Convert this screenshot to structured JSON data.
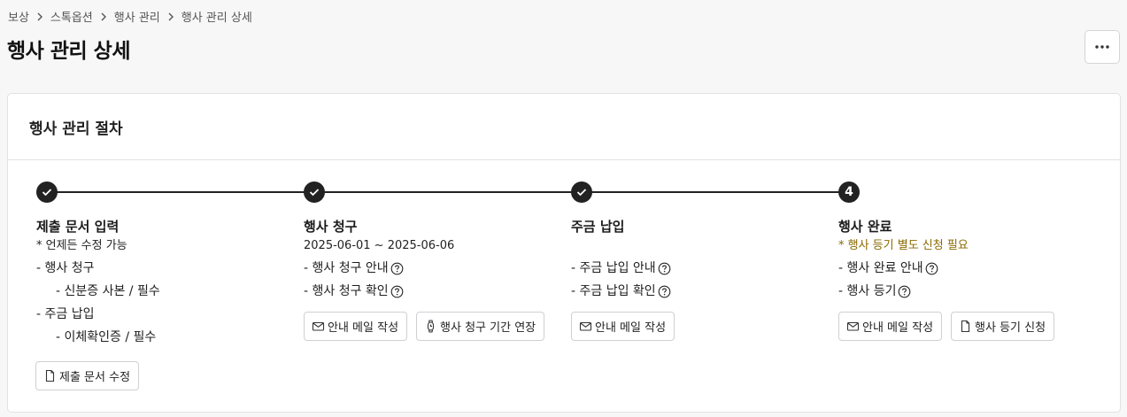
{
  "breadcrumb": [
    "보상",
    "스톡옵션",
    "행사 관리",
    "행사 관리 상세"
  ],
  "page_title": "행사 관리 상세",
  "card": {
    "title": "행사 관리 절차",
    "steps": [
      {
        "marker": "",
        "status": "completed",
        "title": "제출 문서 입력",
        "subtitle": "* 언제든 수정 가능",
        "items": [
          "- 행사 청구",
          "- 신분증 사본 / 필수",
          "- 주금 납입",
          "- 이체확인증 / 필수"
        ],
        "button": "제출 문서 수정"
      },
      {
        "marker": "",
        "status": "completed",
        "title": "행사 청구",
        "subtitle": "2025-06-01 ~ 2025-06-06",
        "items": [
          "- 행사 청구 안내",
          "- 행사 청구 확인"
        ],
        "buttons": [
          "안내 메일 작성",
          "행사 청구 기간 연장"
        ]
      },
      {
        "marker": "",
        "status": "completed",
        "title": "주금 납입",
        "subtitle": "",
        "items": [
          "- 주금 납입 안내",
          "- 주금 납입 확인"
        ],
        "buttons": [
          "안내 메일 작성"
        ]
      },
      {
        "marker": "4",
        "status": "current",
        "title": "행사 완료",
        "subtitle": "* 행사 등기 별도 신청 필요",
        "items": [
          "- 행사 완료 안내",
          "- 행사 등기"
        ],
        "buttons": [
          "안내 메일 작성",
          "행사 등기 신청"
        ]
      }
    ]
  },
  "colors": {
    "step_line": "#222222",
    "warning_text": "#8a6a00",
    "background": "#f7f7f8"
  },
  "icons": {
    "breadcrumb_separator": "chevron-right-icon",
    "more": "more-horizontal-icon",
    "done": "check-icon",
    "help": "question-circle-icon",
    "mail": "mail-icon",
    "document": "document-icon",
    "timer": "stopwatch-icon"
  }
}
